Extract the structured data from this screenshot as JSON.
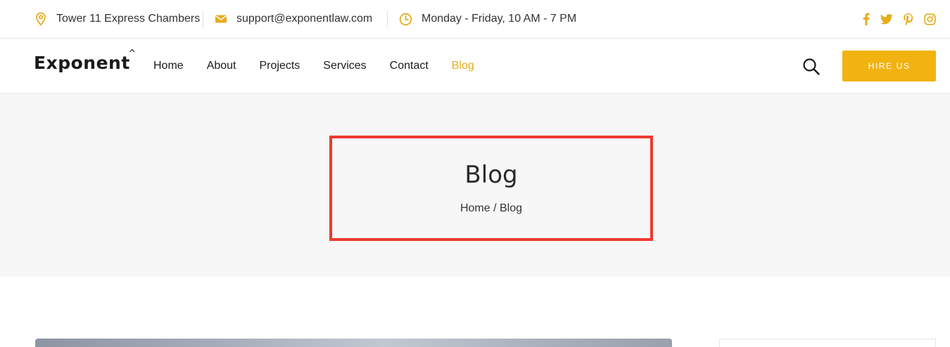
{
  "topbar": {
    "address": "Tower 11 Express Chambers",
    "email": "support@exponentlaw.com",
    "hours": "Monday - Friday, 10 AM - 7 PM",
    "social": [
      "facebook-icon",
      "twitter-icon",
      "pinterest-icon",
      "instagram-icon"
    ]
  },
  "logo": {
    "text": "Exponent",
    "mark": "^"
  },
  "nav": {
    "items": [
      "Home",
      "About",
      "Projects",
      "Services",
      "Contact",
      "Blog"
    ],
    "active": "Blog"
  },
  "actions": {
    "hire_label": "HIRE US"
  },
  "page": {
    "title": "Blog",
    "breadcrumb": {
      "home": "Home",
      "separator": " / ",
      "current": "Blog"
    }
  },
  "colors": {
    "accent": "#f2b311",
    "active_link": "#e5ad1c",
    "highlight_border": "#ee3a2f",
    "header_bg": "#f7f7f7"
  }
}
